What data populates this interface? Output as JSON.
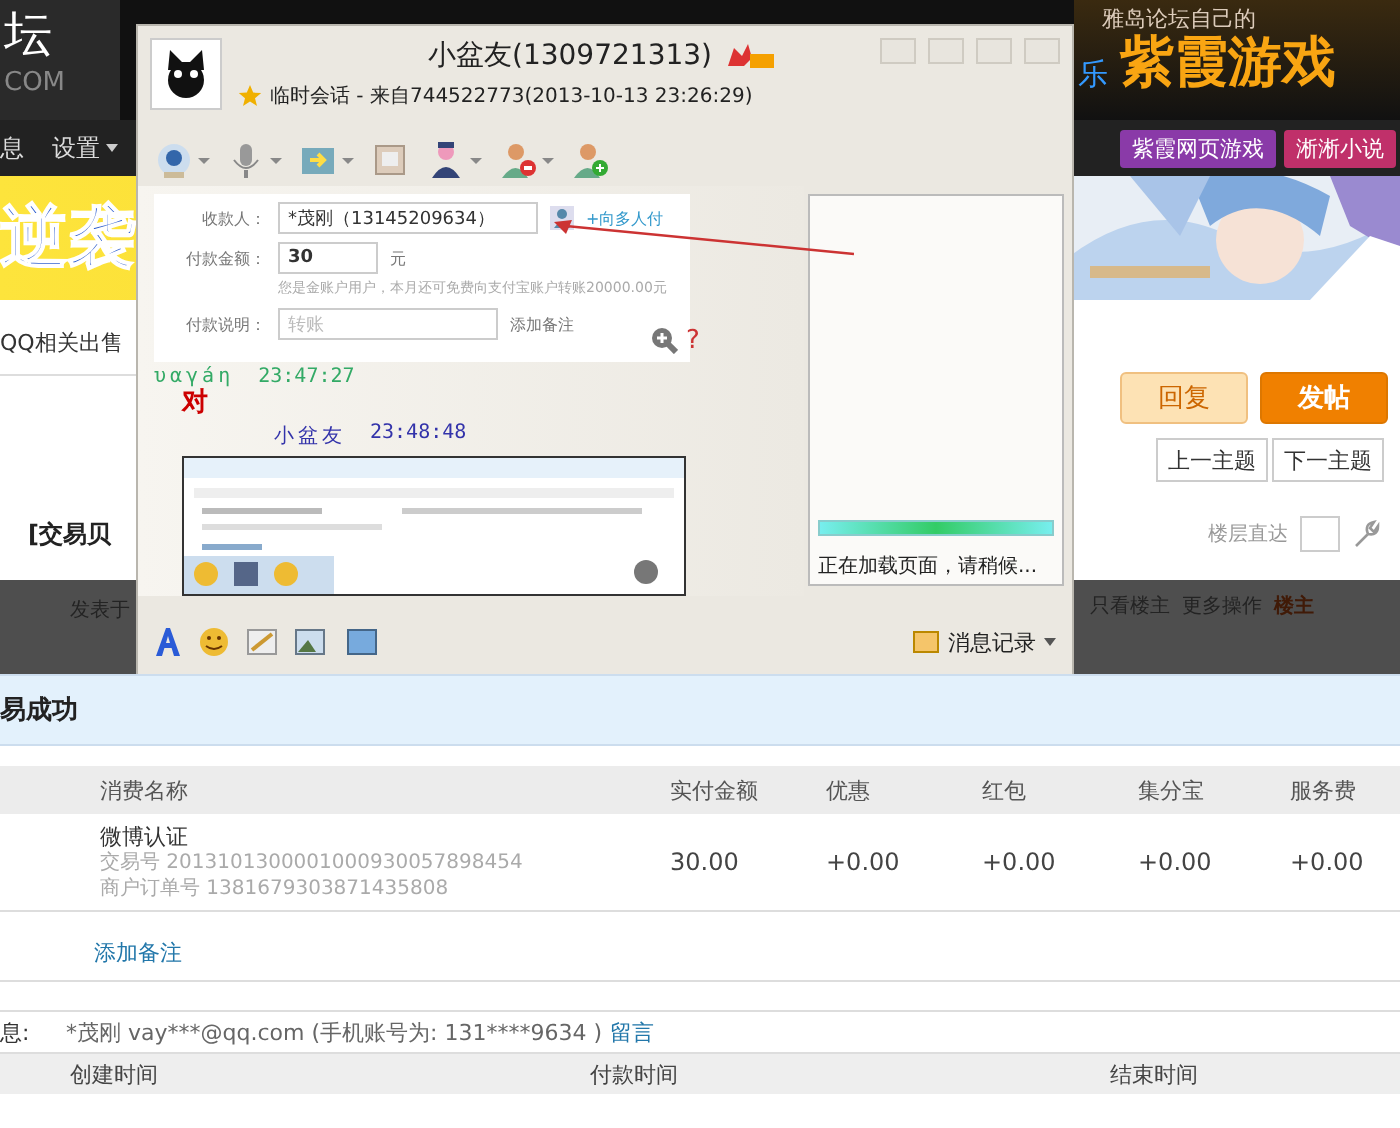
{
  "forum": {
    "logo": "坛",
    "logo_sub": "COM",
    "banner_slogan": "雅岛论坛自己的",
    "banner_fragment": "乐",
    "banner_title": "紫霞游戏",
    "nav": [
      {
        "label": "息",
        "menu": false
      },
      {
        "label": "设置",
        "menu": true
      }
    ],
    "nav_links": [
      "紫霞网页游戏",
      "淅淅小说"
    ],
    "banner_text": "逆袭",
    "breadcrumb": "QQ相关出售",
    "reply_button": "回复",
    "post_button": "发帖",
    "prev_topic": "上一主题",
    "next_topic": "下一主题",
    "thread_title": "[交易贝",
    "floor_jump": "楼层直达",
    "post_meta": "发表于",
    "post_actions": [
      "只看楼主",
      "更多操作"
    ],
    "author_badge": "楼主"
  },
  "qq_window": {
    "contact": "小盆友(1309721313)",
    "session": "临时会话 - 来自744522773(2013-10-13 23:26:29)",
    "shared_form": {
      "payee_label": "收款人：",
      "payee": "*茂刚（13145209634）",
      "multi_link": "+向多人付",
      "amount_label": "付款金额：",
      "amount": "30",
      "unit": "元",
      "hint": "您是金账户用户，本月还可免费向支付宝账户转账20000.00元",
      "note_label": "付款说明：",
      "note_placeholder": "转账",
      "note_link": "添加备注",
      "help": "?"
    },
    "messages": [
      {
        "kind": "header",
        "sender": "υαγáη",
        "time": "23:47:27"
      },
      {
        "kind": "text",
        "text": "对"
      },
      {
        "kind": "header",
        "sender": "小盆友",
        "time": "23:48:48"
      },
      {
        "kind": "picture"
      }
    ],
    "history_button": "消息记录",
    "loading": {
      "level": 1,
      "text": "正在加载页面，请稍候..."
    }
  },
  "receipt": {
    "title": "易成功",
    "columns": [
      "消费名称",
      "实付金额",
      "优惠",
      "红包",
      "集分宝",
      "服务费"
    ],
    "rows": [
      {
        "cells": [
          "微博认证",
          "30.00",
          "+0.00",
          "+0.00",
          "+0.00",
          "+0.00"
        ],
        "trade_no": "交易号 2013101300001000930057898454",
        "order_no": "商户订单号 1381679303871435808"
      }
    ],
    "add_note": "添加备注",
    "info_label": "息:",
    "info": "*茂刚 vay***@qq.com (手机账号为: 131****9634 )",
    "info_link": "留言",
    "time_columns": [
      "创建时间",
      "付款时间",
      "结束时间"
    ]
  }
}
